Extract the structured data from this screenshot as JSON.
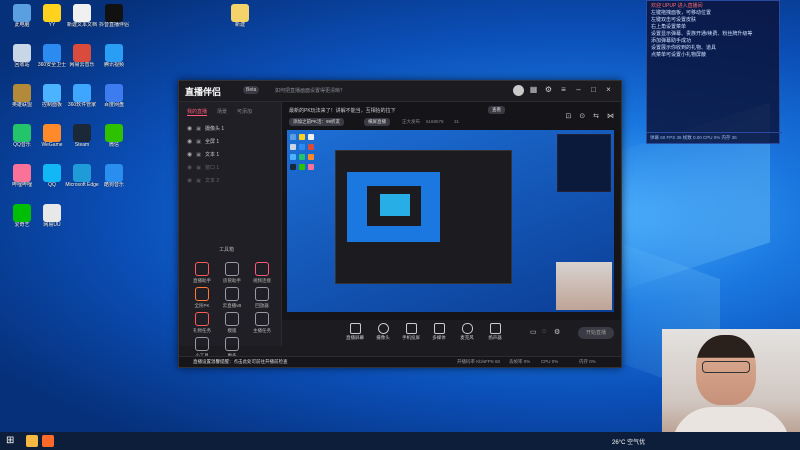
{
  "desktop": {
    "icons": [
      {
        "label": "此电脑",
        "color": "#5aa0e0"
      },
      {
        "label": "YY",
        "color": "#ffd21e"
      },
      {
        "label": "新建文本文档",
        "color": "#f0f0f0"
      },
      {
        "label": "抖音直播伴侣",
        "color": "#111111"
      },
      {
        "label": "回收站",
        "color": "#c9d6e6"
      },
      {
        "label": "360安全卫士",
        "color": "#2c8bf0"
      },
      {
        "label": "网易云音乐",
        "color": "#d94b3d"
      },
      {
        "label": "腾讯视频",
        "color": "#2a9df4"
      },
      {
        "label": "英雄联盟",
        "color": "#b28a3a"
      },
      {
        "label": "控制面板",
        "color": "#4cb4ff"
      },
      {
        "label": "360软件管家",
        "color": "#3ea6ff"
      },
      {
        "label": "百度网盘",
        "color": "#3d7bf0"
      },
      {
        "label": "QQ音乐",
        "color": "#23c46a"
      },
      {
        "label": "WeGame",
        "color": "#ff8a2a"
      },
      {
        "label": "Steam",
        "color": "#1b2838"
      },
      {
        "label": "微信",
        "color": "#2dc100"
      },
      {
        "label": "哔哩哔哩",
        "color": "#fb7299"
      },
      {
        "label": "QQ",
        "color": "#12b7f5"
      },
      {
        "label": "Microsoft Edge",
        "color": "#1f9bd8"
      },
      {
        "label": "酷狗音乐",
        "color": "#2a8df0"
      },
      {
        "label": "爱奇艺",
        "color": "#00be06"
      },
      {
        "label": "网易UU",
        "color": "#e8e8e8"
      }
    ],
    "folder_label": "新建"
  },
  "app": {
    "logo": "直播伴侣",
    "version": "Beta",
    "notice": "如何把直播画面设置得更清晰？",
    "left_tabs": [
      "我的直播",
      "场景",
      "可添加"
    ],
    "sources": [
      "摄像头 1",
      "全屏 1",
      "文本 1",
      "窗口 1",
      "文本 2"
    ],
    "tools_title": "工具箱",
    "tools": [
      {
        "label": "直播助手",
        "color": "#ff5a5a"
      },
      {
        "label": "房管助手",
        "color": "#9a9aa6"
      },
      {
        "label": "视频连接",
        "color": "#ff5a7a"
      },
      {
        "label": "全民PK",
        "color": "#ff7a3a"
      },
      {
        "label": "云直播vB",
        "color": "#9a9aa6"
      },
      {
        "label": "回放器",
        "color": "#9a9aa6"
      },
      {
        "label": "礼物任务",
        "color": "#ff5a5a"
      },
      {
        "label": "模版",
        "color": "#9a9aa6"
      },
      {
        "label": "主播任务",
        "color": "#9a9aa6"
      },
      {
        "label": "小工具",
        "color": "#9a9aa6"
      },
      {
        "label": "更多",
        "color": "#9a9aa6"
      }
    ],
    "preview_notice": "最新的PK玩法来了！讲解不能当，互相抬的拉下",
    "preview_notice_button": "查看",
    "pv_buttons": [
      "添加之前PK活：99折友",
      "横屏直播"
    ],
    "pv_stats": [
      "正大发布",
      "6168578",
      "31"
    ],
    "bottom_tools": [
      "直播屏幕",
      "摄像头",
      "手机投屏",
      "多媒体",
      "麦克风",
      "扬声器"
    ],
    "start_live": "开始直播",
    "status_text": "直播设置温馨提醒：点击此处可前往开播前检查",
    "status_right": [
      "开播码率 Kb/s",
      "FPS 60",
      "丢帧率 0%",
      "CPU 0%",
      "内存 0%"
    ]
  },
  "chat": {
    "lines": [
      {
        "text": "欢迎 UPUP 进入直播间",
        "red": true
      },
      {
        "text": "左键拖拽面板，可移动位置",
        "red": false
      },
      {
        "text": "左键双击可设置皮肤",
        "red": false
      },
      {
        "text": "右上角设置菜单",
        "red": false
      },
      {
        "text": "设置显示弹幕、贵族开通/续费、粉丝牌升级等",
        "red": false
      },
      {
        "text": "添加弹幕助手成功",
        "red": false
      },
      {
        "text": "设置展示你收到的礼物、道具",
        "red": false
      },
      {
        "text": "点菜单可设置小礼物屏蔽",
        "red": false
      }
    ],
    "footer": "弹幕 60 FPS 36 帧数 0.00   CPU 0% 内存 36"
  },
  "taskbar": {
    "weather": "26°C 空气优"
  }
}
